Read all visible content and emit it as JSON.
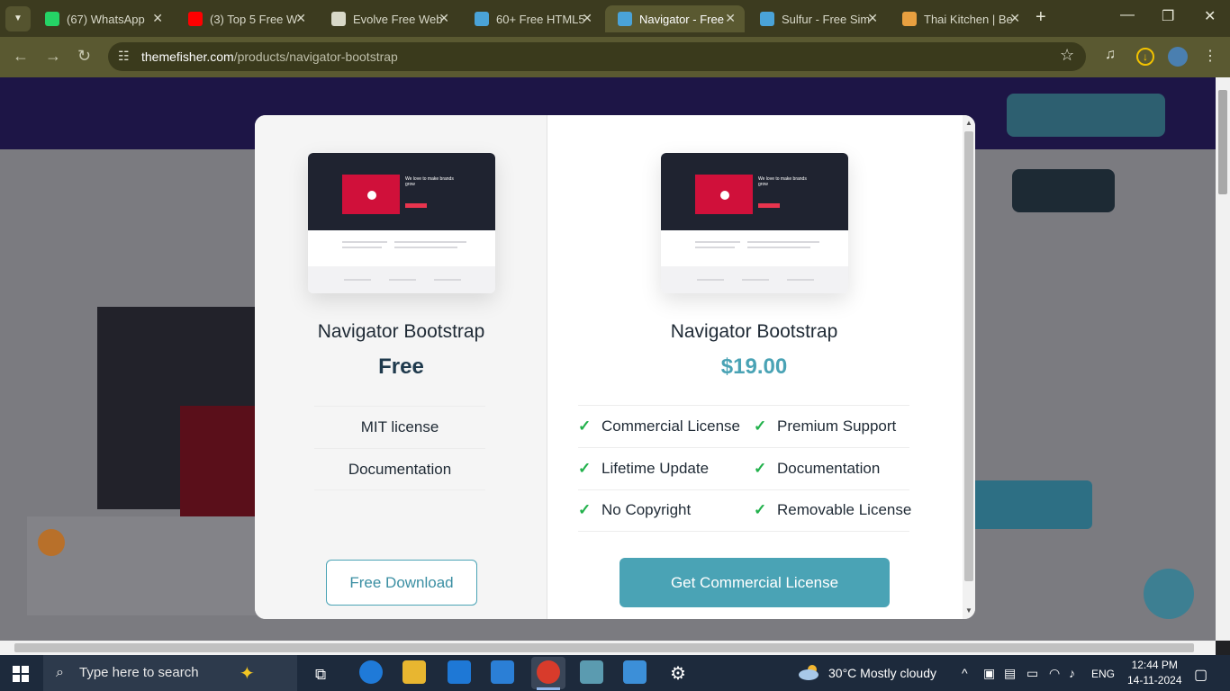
{
  "browser": {
    "tabs": [
      {
        "title": "(67) WhatsApp",
        "color": "#25d366"
      },
      {
        "title": "(3) Top 5 Free W",
        "color": "#ff0000"
      },
      {
        "title": "Evolve Free Web",
        "color": "#d8d8c8"
      },
      {
        "title": "60+ Free HTML5",
        "color": "#4aa3d8"
      },
      {
        "title": "Navigator - Free",
        "color": "#4aa3d8"
      },
      {
        "title": "Sulfur - Free Sim",
        "color": "#4aa3d8"
      },
      {
        "title": "Thai Kitchen | Be",
        "color": "#e8a040"
      }
    ],
    "active_tab_index": 4,
    "url_host": "themefisher.com",
    "url_path": "/products/navigator-bootstrap"
  },
  "modal": {
    "free": {
      "title": "Navigator Bootstrap",
      "price": "Free",
      "features": [
        "MIT license",
        "Documentation"
      ],
      "button": "Free Download"
    },
    "commercial": {
      "title": "Navigator Bootstrap",
      "price": "$19.00",
      "features_left": [
        "Commercial License",
        "Lifetime Update",
        "No Copyright"
      ],
      "features_right": [
        "Premium Support",
        "Documentation",
        "Removable License"
      ],
      "button": "Get Commercial License"
    },
    "preview": {
      "headline": "We love to make brands grow",
      "subhead": "We have explored the digital landscape with passion for a long time"
    }
  },
  "taskbar": {
    "search_placeholder": "Type here to search",
    "weather": "30°C  Mostly cloudy",
    "language": "ENG",
    "time": "12:44 PM",
    "date": "14-11-2024"
  },
  "colors": {
    "accent": "#4aa3b5",
    "check": "#22b14c",
    "price_free": "#1f3a4d"
  }
}
